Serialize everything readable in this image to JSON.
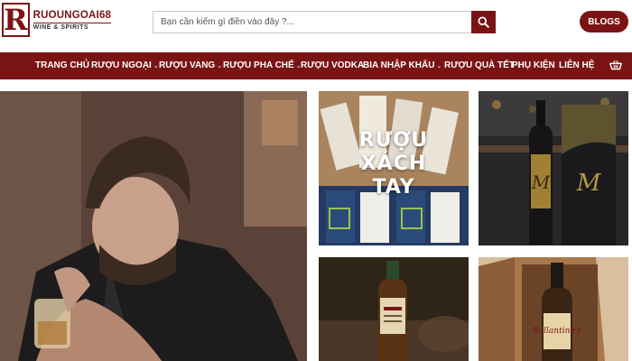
{
  "brand": {
    "logo_letter": "R",
    "name": "RUOUNGOAI68",
    "tagline": "WINE & SPIRITS",
    "accent": "#7a1414"
  },
  "search": {
    "placeholder": "Bạn cần kiếm gì điền vào đây ?...",
    "icon": "search-icon"
  },
  "header": {
    "blogs_label": "BLOGS"
  },
  "nav": {
    "items": [
      {
        "label": "TRANG CHỦ",
        "has_dropdown": false
      },
      {
        "label": "RƯỢU NGOẠI",
        "has_dropdown": true
      },
      {
        "label": "RƯỢU VANG",
        "has_dropdown": true
      },
      {
        "label": "RƯỢU PHA CHẾ",
        "has_dropdown": true
      },
      {
        "label": "RƯỢU VODKA",
        "has_dropdown": false
      },
      {
        "label": "BIA NHẬP KHẨU",
        "has_dropdown": true
      },
      {
        "label": "RƯỢU QUÀ TẾT",
        "has_dropdown": true
      },
      {
        "label": "PHỤ KIỆN",
        "has_dropdown": false
      },
      {
        "label": "LIÊN HỆ",
        "has_dropdown": false
      }
    ],
    "cart_icon": "cart-icon"
  },
  "banners": {
    "xach_tay_text": "RƯỢU XÁCH TAY"
  }
}
